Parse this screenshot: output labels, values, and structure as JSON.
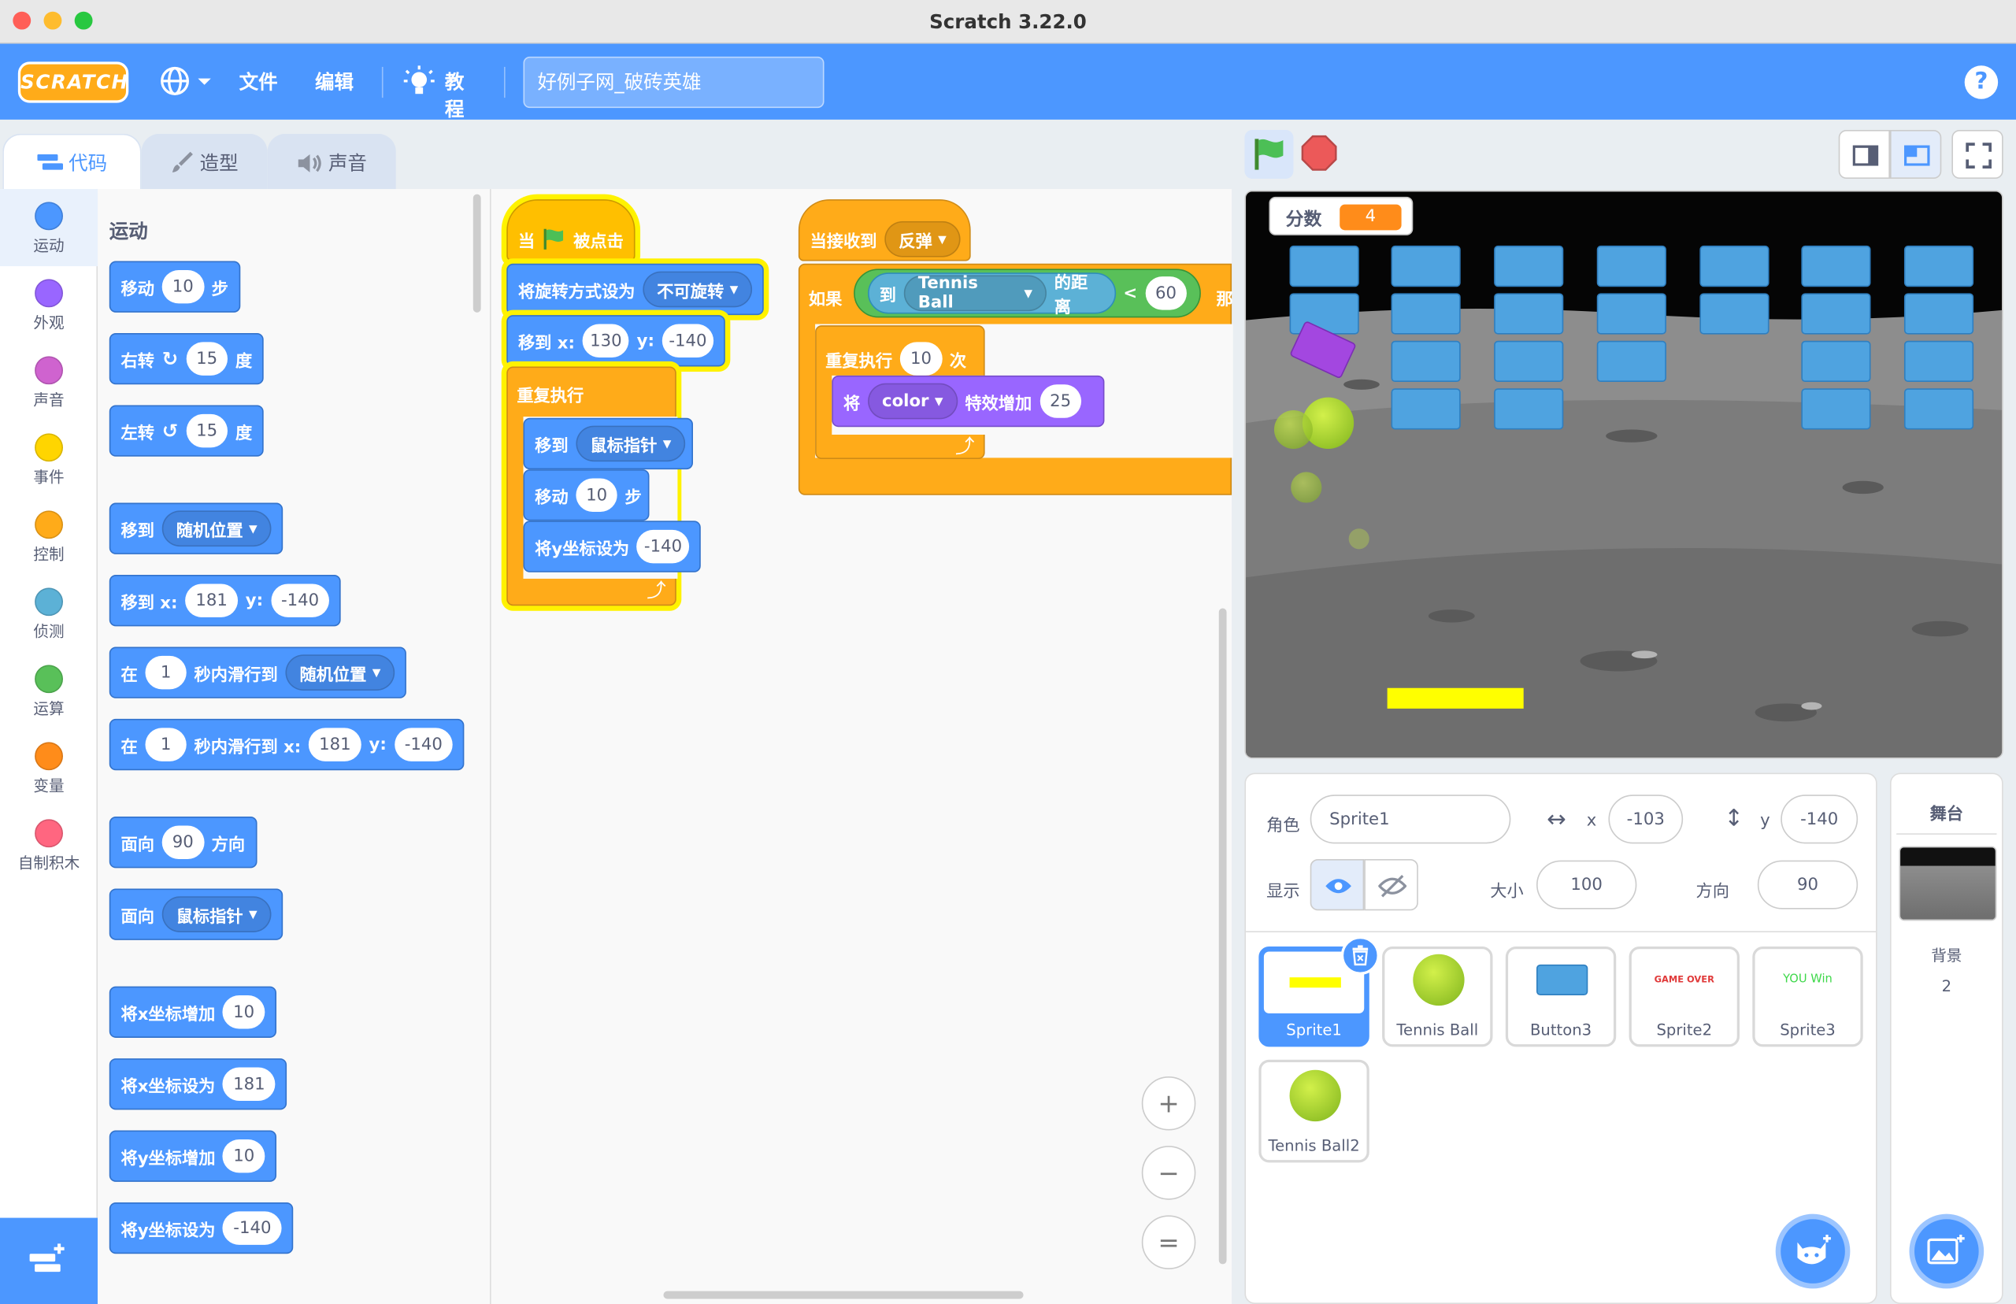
{
  "window": {
    "title": "Scratch 3.22.0"
  },
  "menu": {
    "logo": "SCRATCH",
    "file": "文件",
    "edit": "编辑",
    "tutorials": "教程",
    "project_title": "好例子网_破砖英雄",
    "help": "?"
  },
  "tabs": {
    "code": "代码",
    "costumes": "造型",
    "sounds": "声音"
  },
  "categories": [
    "运动",
    "外观",
    "声音",
    "事件",
    "控制",
    "侦测",
    "运算",
    "变量",
    "自制积木"
  ],
  "category_colors": [
    "#4c97ff",
    "#9966ff",
    "#cf63cf",
    "#ffd500",
    "#ffab19",
    "#5cb1d6",
    "#59c059",
    "#ff8c1a",
    "#ff6680"
  ],
  "palette": {
    "heading": "运动",
    "move": {
      "a": "移动",
      "n": "10",
      "b": "步"
    },
    "turn_right": {
      "a": "右转",
      "n": "15",
      "b": "度"
    },
    "turn_left": {
      "a": "左转",
      "n": "15",
      "b": "度"
    },
    "goto_random": {
      "a": "移到",
      "dd": "随机位置"
    },
    "goto_xy": {
      "a": "移到 x:",
      "x": "181",
      "b": "y:",
      "y": "-140"
    },
    "glide_random": {
      "a": "在",
      "n": "1",
      "b": "秒内滑行到",
      "dd": "随机位置"
    },
    "glide_xy": {
      "a": "在",
      "n": "1",
      "b": "秒内滑行到 x:",
      "x": "181",
      "c": "y:",
      "y": "-140"
    },
    "point_dir": {
      "a": "面向",
      "n": "90",
      "b": "方向"
    },
    "point_towards": {
      "a": "面向",
      "dd": "鼠标指针"
    },
    "change_x": {
      "a": "将x坐标增加",
      "n": "10"
    },
    "set_x": {
      "a": "将x坐标设为",
      "n": "181"
    },
    "change_y": {
      "a": "将y坐标增加",
      "n": "10"
    },
    "set_y": {
      "a": "将y坐标设为",
      "n": "-140"
    }
  },
  "script1": {
    "hat_a": "当",
    "hat_b": "被点击",
    "rot_a": "将旋转方式设为",
    "rot_dd": "不可旋转",
    "goto_a": "移到 x:",
    "goto_x": "130",
    "goto_b": "y:",
    "goto_y": "-140",
    "forever": "重复执行",
    "inner_goto_a": "移到",
    "inner_goto_dd": "鼠标指针",
    "inner_move_a": "移动",
    "inner_move_n": "10",
    "inner_move_b": "步",
    "inner_sety_a": "将y坐标设为",
    "inner_sety_n": "-140"
  },
  "script2": {
    "hat_a": "当接收到",
    "hat_dd": "反弹",
    "if_a": "如果",
    "dist_a": "到",
    "dist_dd": "Tennis Ball",
    "dist_b": "的距离",
    "lt": "<",
    "lt_n": "60",
    "then": "那",
    "repeat_a": "重复执行",
    "repeat_n": "10",
    "repeat_b": "次",
    "effect_a": "将",
    "effect_dd": "color",
    "effect_b": "特效增加",
    "effect_n": "25"
  },
  "zoom": {
    "in": "+",
    "out": "−",
    "reset": "="
  },
  "stage": {
    "score_label": "分数",
    "score_value": "4"
  },
  "sprite_info": {
    "sprite_label": "角色",
    "sprite_name": "Sprite1",
    "x_label": "x",
    "x": "-103",
    "y_label": "y",
    "y": "-140",
    "show_label": "显示",
    "size_label": "大小",
    "size": "100",
    "direction_label": "方向",
    "direction": "90"
  },
  "sprites": [
    {
      "name": "Sprite1"
    },
    {
      "name": "Tennis Ball"
    },
    {
      "name": "Button3"
    },
    {
      "name": "Sprite2",
      "thumb_text": "GAME OVER"
    },
    {
      "name": "Sprite3",
      "thumb_text": "YOU Win"
    },
    {
      "name": "Tennis Ball2"
    }
  ],
  "stage_panel": {
    "title": "舞台",
    "backdrop_label": "背景",
    "backdrop_count": "2"
  }
}
